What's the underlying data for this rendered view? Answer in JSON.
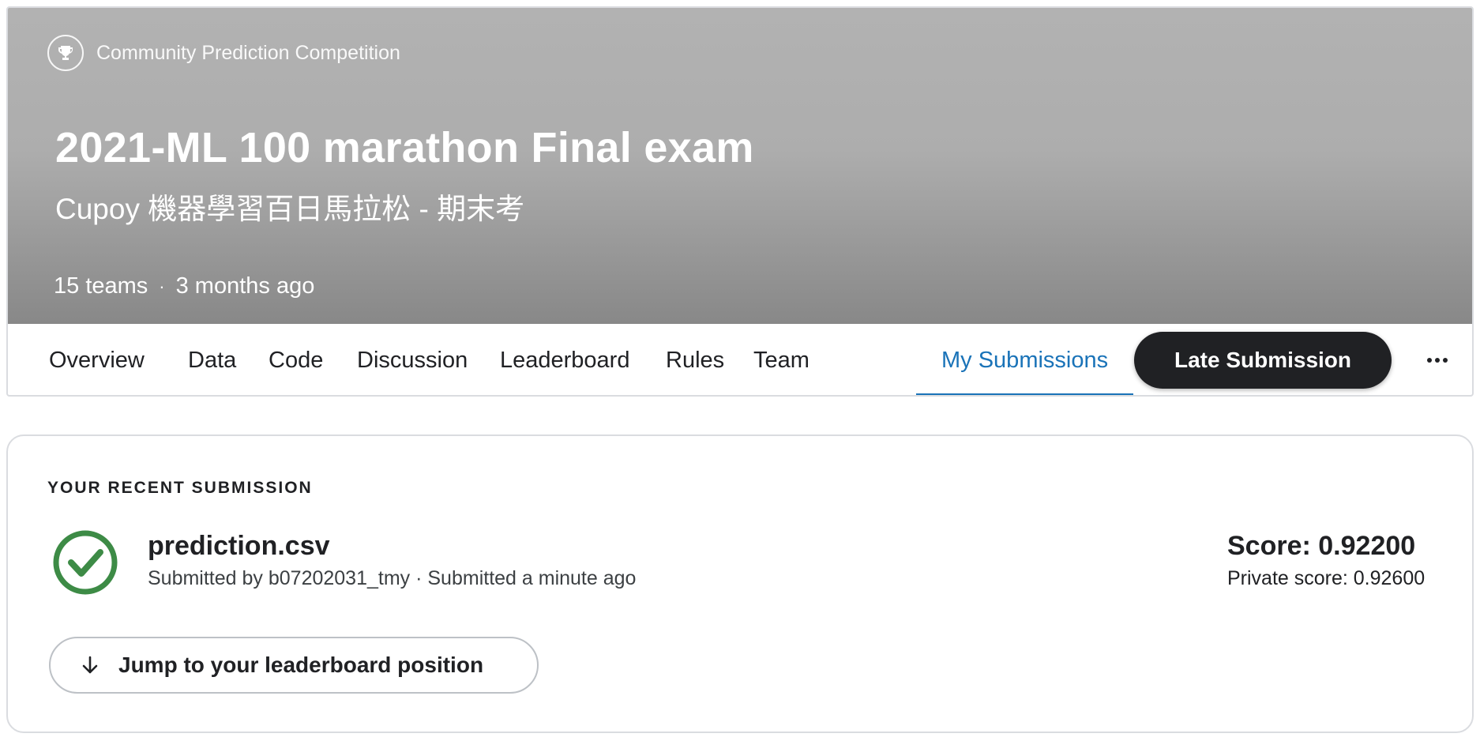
{
  "header": {
    "competition_type": "Community Prediction Competition",
    "icon": "trophy-icon",
    "title": "2021-ML 100 marathon Final exam",
    "subtitle": "Cupoy 機器學習百日馬拉松 - 期末考",
    "teams": "15 teams",
    "separator": "·",
    "time_ago": "3 months ago"
  },
  "tabs": {
    "overview": "Overview",
    "data": "Data",
    "code": "Code",
    "discussion": "Discussion",
    "leaderboard": "Leaderboard",
    "rules": "Rules",
    "team": "Team",
    "my_submissions": "My Submissions",
    "active": "My Submissions"
  },
  "actions": {
    "late_submission": "Late Submission",
    "more_icon": "more-horizontal-icon"
  },
  "submission": {
    "section_label": "YOUR RECENT SUBMISSION",
    "status_icon": "check-circle-icon",
    "file_name": "prediction.csv",
    "submitted_line": "Submitted by b07202031_tmy · Submitted a minute ago",
    "score": "Score: 0.92200",
    "private_score": "Private score: 0.92600",
    "jump_label": "Jump to your leaderboard position",
    "jump_icon": "arrow-down-icon"
  },
  "colors": {
    "accent": "#1a73b8",
    "success": "#3d8b46",
    "dark_button": "#202124"
  }
}
